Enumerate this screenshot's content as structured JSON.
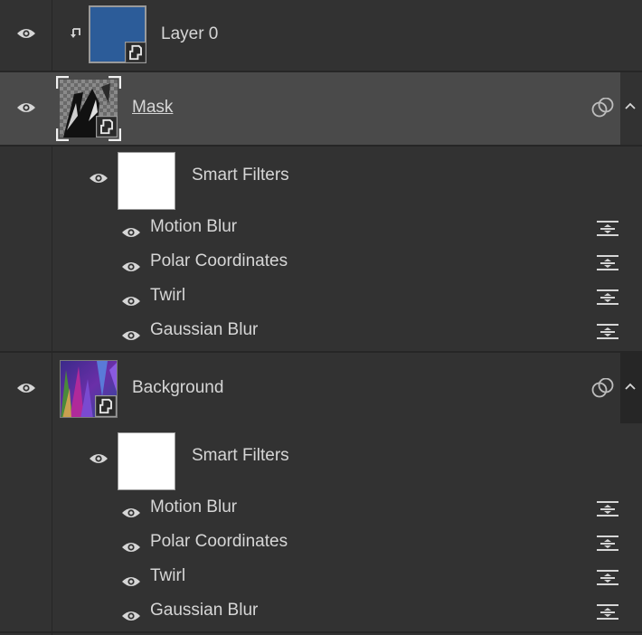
{
  "layers": [
    {
      "name": "Layer 0"
    },
    {
      "name": "Mask"
    },
    {
      "name": "Background"
    }
  ],
  "groups": [
    {
      "smart_filters_label": "Smart Filters",
      "filters": [
        "Motion Blur",
        "Polar Coordinates",
        "Twirl",
        "Gaussian Blur"
      ]
    },
    {
      "smart_filters_label": "Smart Filters",
      "filters": [
        "Motion Blur",
        "Polar Coordinates",
        "Twirl",
        "Gaussian Blur"
      ]
    }
  ],
  "icons": {
    "visibility": "eye-icon",
    "clipping": "clipping-arrow-icon",
    "smart_object": "smart-object-badge-icon",
    "link": "link-circles-icon",
    "expand": "chevron-up-icon",
    "filter_options": "filter-blending-options-icon"
  },
  "colors": {
    "panel_bg": "#323232",
    "selected_row_bg": "#4a4a4a",
    "divider": "#262626",
    "text": "#d6d6d6"
  }
}
